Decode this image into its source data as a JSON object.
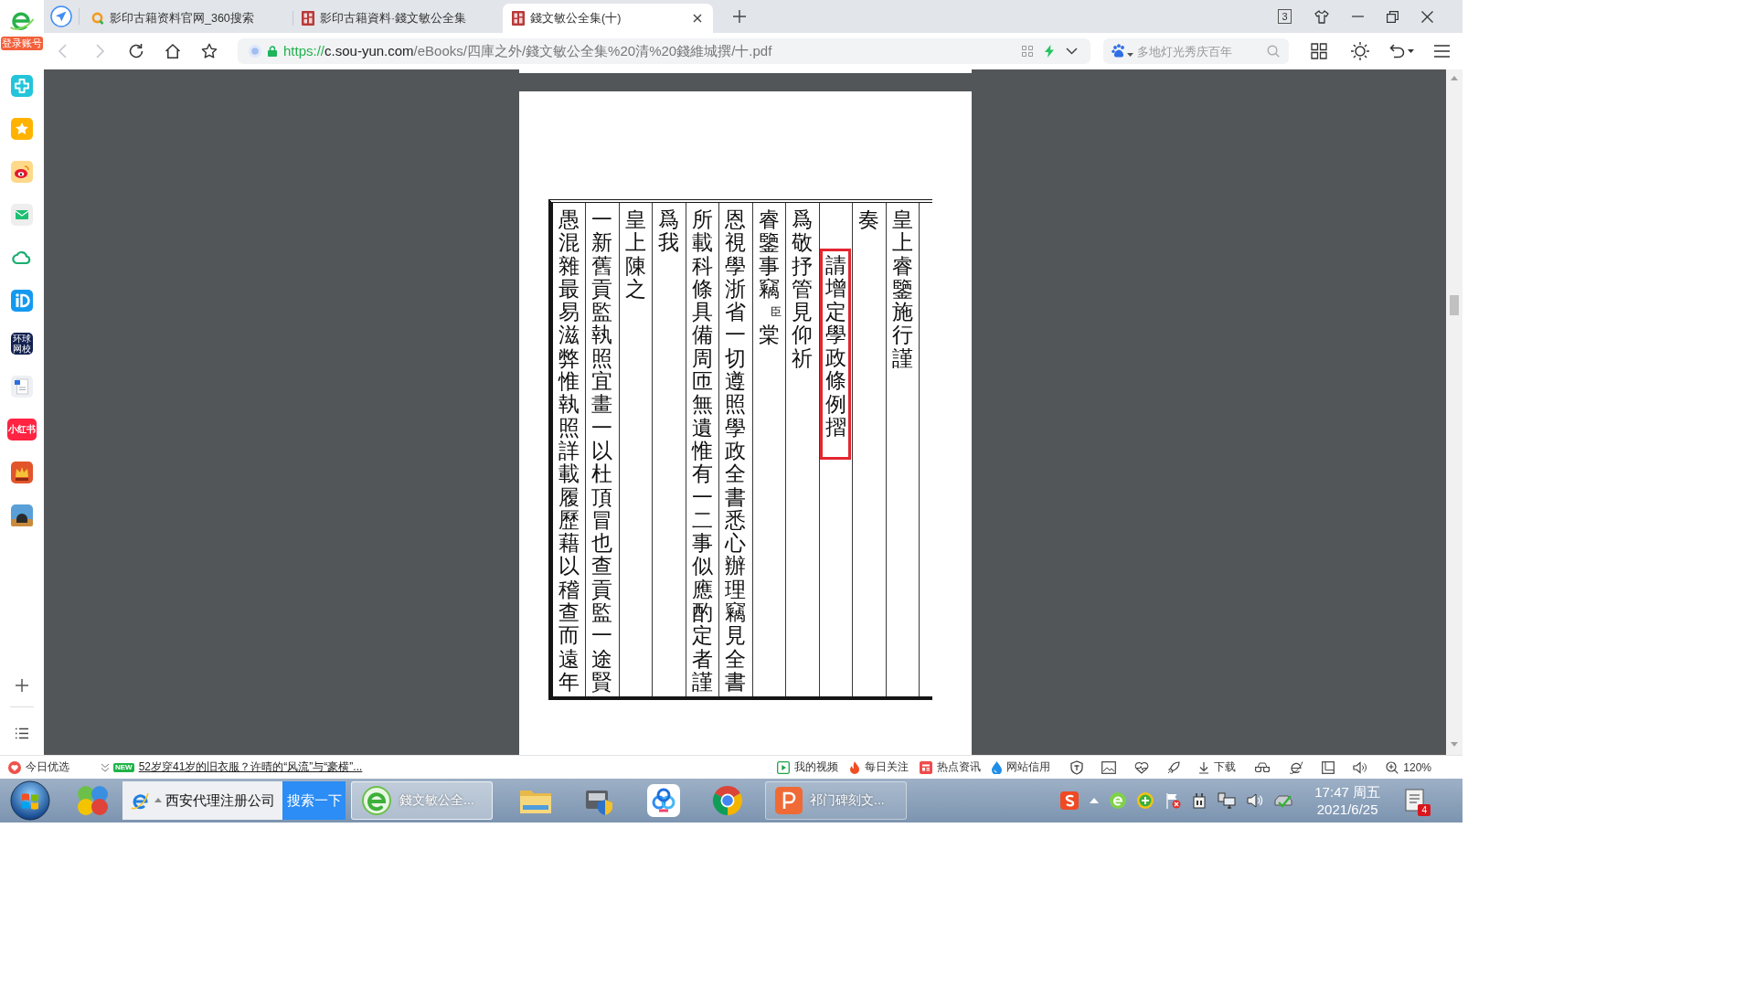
{
  "sidebar": {
    "badge": "登录账号",
    "app_tiles": [
      {
        "label": "环球网校"
      },
      {
        "label": "小红书"
      }
    ]
  },
  "tabs": [
    {
      "kind": "search",
      "title": "影印古籍资料官网_360搜索",
      "selected": false
    },
    {
      "kind": "seal",
      "title": "影印古籍資料·錢文敏公全集",
      "selected": false
    },
    {
      "kind": "seal",
      "title": "錢文敏公全集(十)",
      "selected": true
    }
  ],
  "window_controls": {
    "tab_count": "3"
  },
  "toolbar": {
    "back": {
      "disabled": true
    },
    "forward": {
      "disabled": true
    },
    "url": [
      {
        "kind": "scheme",
        "text": "https://"
      },
      {
        "kind": "host",
        "text": "c.sou-yun.com"
      },
      {
        "kind": "path",
        "text": "/eBooks/四庫之外/錢文敏公全集%20清%20錢維城撰/十.pdf"
      }
    ],
    "search": {
      "placeholder": "多地灯光秀庆百年"
    }
  },
  "document": {
    "columns": [
      {
        "kind": "text",
        "highlighted": false,
        "segments": [
          {
            "kind": "main",
            "text": "愚混雜最易滋弊惟執照詳載履歷藉以稽查而遠年"
          }
        ]
      },
      {
        "kind": "text",
        "highlighted": false,
        "segments": [
          {
            "kind": "main",
            "text": "一新舊貢監執照宜畫一以杜頂冒也查貢監一途賢"
          }
        ]
      },
      {
        "kind": "text",
        "highlighted": false,
        "segments": [
          {
            "kind": "main",
            "text": "皇上陳之"
          }
        ]
      },
      {
        "kind": "text",
        "highlighted": false,
        "segments": [
          {
            "kind": "main",
            "text": "爲我"
          }
        ]
      },
      {
        "kind": "text",
        "highlighted": false,
        "segments": [
          {
            "kind": "main",
            "text": "所載科條具備周匝無遺惟有一二事似應酌定者謹"
          }
        ]
      },
      {
        "kind": "text",
        "highlighted": false,
        "segments": [
          {
            "kind": "main",
            "text": "恩視學浙省一切遵照學政全書悉心辦理竊見全書"
          }
        ]
      },
      {
        "kind": "text",
        "highlighted": false,
        "segments": [
          {
            "kind": "main",
            "text": "睿鑒事竊"
          },
          {
            "kind": "note",
            "text": "臣"
          },
          {
            "kind": "main",
            "text": "棠"
          }
        ]
      },
      {
        "kind": "text",
        "highlighted": false,
        "segments": [
          {
            "kind": "main",
            "text": "爲敬抒管見仰祈"
          }
        ]
      },
      {
        "kind": "title",
        "highlighted": true,
        "segments": [
          {
            "kind": "main",
            "text": "請增定學政條例摺"
          }
        ]
      },
      {
        "kind": "text",
        "highlighted": false,
        "segments": [
          {
            "kind": "main",
            "text": "奏"
          }
        ]
      },
      {
        "kind": "text",
        "highlighted": false,
        "segments": [
          {
            "kind": "main",
            "text": "皇上睿鑒施行謹"
          }
        ]
      }
    ]
  },
  "status_bar": {
    "picks": "今日优选",
    "news": {
      "badge": "NEW",
      "headline": "52岁穿41岁的旧衣服？许晴的“风流”与“豪横”..."
    },
    "links": [
      {
        "kind": "video",
        "label": "我的视频"
      },
      {
        "kind": "hot",
        "label": "每日关注"
      },
      {
        "kind": "news",
        "label": "热点资讯"
      },
      {
        "kind": "credit",
        "label": "网站信用"
      }
    ],
    "download": "下载",
    "zoom": "120%"
  },
  "taskbar": {
    "search": {
      "value": "西安代理注册公司",
      "button": "搜索一下"
    },
    "windows": [
      {
        "kind": "browser",
        "title": "錢文敏公全...",
        "selected": true
      },
      {
        "kind": "slides",
        "title": "祁门碑刻文...",
        "selected": false
      }
    ],
    "clock": {
      "time": "17:47 周五",
      "date": "2021/6/25"
    },
    "notifications": "4"
  }
}
